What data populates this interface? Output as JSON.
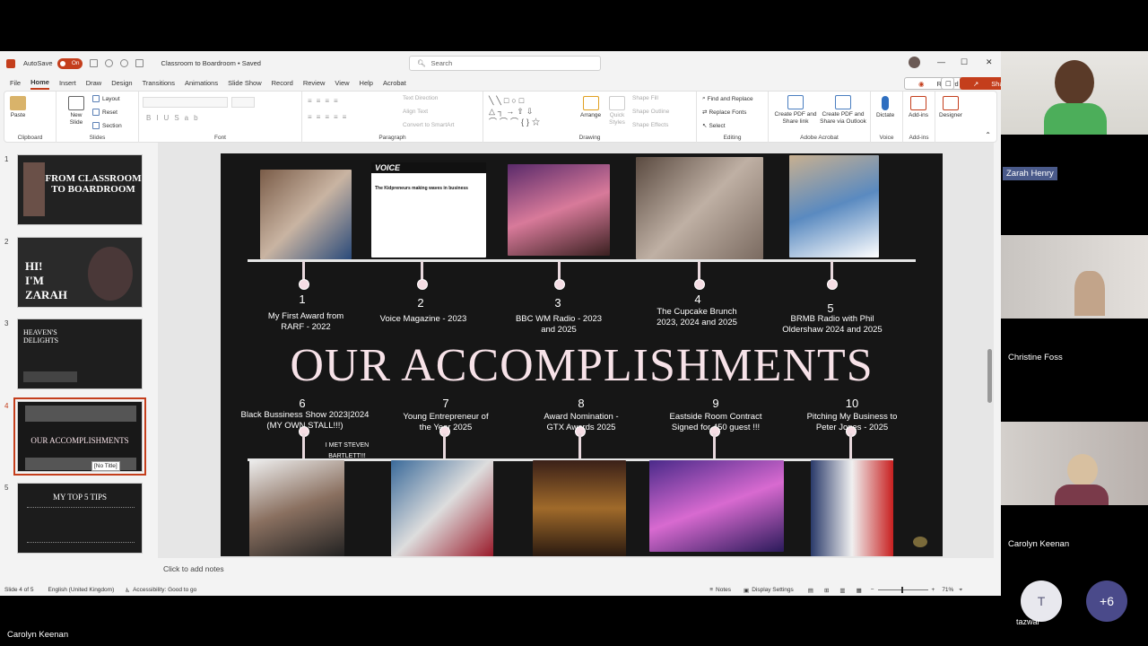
{
  "app": {
    "autosave": "AutoSave",
    "toggle": "On",
    "doc_title": "Classroom to Boardroom • Saved",
    "search_placeholder": "Search"
  },
  "tabs": [
    "File",
    "Home",
    "Insert",
    "Draw",
    "Design",
    "Transitions",
    "Animations",
    "Slide Show",
    "Record",
    "Review",
    "View",
    "Help",
    "Acrobat"
  ],
  "top_buttons": {
    "record": "Record",
    "share": "Share"
  },
  "ribbon": {
    "clipboard": {
      "label": "Clipboard",
      "paste": "Paste"
    },
    "slides": {
      "label": "Slides",
      "new_slide": "New Slide",
      "layout": "Layout",
      "reset": "Reset",
      "section": "Section"
    },
    "font": {
      "label": "Font"
    },
    "paragraph": {
      "label": "Paragraph",
      "text_direction": "Text Direction",
      "align_text": "Align Text",
      "convert": "Convert to SmartArt"
    },
    "drawing": {
      "label": "Drawing",
      "arrange": "Arrange",
      "quick_styles": "Quick Styles",
      "shape_fill": "Shape Fill",
      "shape_outline": "Shape Outline",
      "shape_effects": "Shape Effects"
    },
    "editing": {
      "label": "Editing",
      "find": "Find and Replace",
      "replace_fonts": "Replace Fonts",
      "select": "Select"
    },
    "acrobat": {
      "label": "Adobe Acrobat",
      "pdf_share": "Create PDF and Share link",
      "pdf_outlook": "Create PDF and Share via Outlook"
    },
    "voice": {
      "label": "Voice",
      "dictate": "Dictate"
    },
    "addins": {
      "label": "Add-ins",
      "addins": "Add-ins"
    },
    "designer": {
      "designer": "Designer"
    }
  },
  "thumbnails": [
    {
      "num": "1",
      "title": "FROM CLASSROOM TO BOARDROOM"
    },
    {
      "num": "2",
      "title": "HI! I'M ZARAH"
    },
    {
      "num": "3",
      "title": "HEAVEN'S DELIGHTS"
    },
    {
      "num": "4",
      "title": "OUR ACCOMPLISHMENTS",
      "tooltip": "[No Title]"
    },
    {
      "num": "5",
      "title": "MY TOP 5 TIPS"
    }
  ],
  "slide": {
    "title": "OUR ACCOMPLISHMENTS",
    "voice_logo": "VOICE",
    "voice_headline": "The Kidpreneurs making waves in business",
    "top": [
      {
        "n": "1",
        "text": "My First Award from RARF - 2022"
      },
      {
        "n": "2",
        "text": "Voice Magazine - 2023"
      },
      {
        "n": "3",
        "text": "BBC WM Radio - 2023 and 2025"
      },
      {
        "n": "4",
        "text": "The Cupcake Brunch 2023, 2024 and 2025"
      },
      {
        "n": "5",
        "text": "BRMB Radio with Phil Oldershaw 2024 and 2025"
      }
    ],
    "bottom": [
      {
        "n": "6",
        "text": "Black Bussiness Show 2023|2024 (MY OWN STALL!!!)"
      },
      {
        "n": "7",
        "text": "Young Entrepreneur of the Year 2025"
      },
      {
        "n": "8",
        "text": "Award Nomination - GTX Awards 2025"
      },
      {
        "n": "9",
        "text": "Eastside Room Contract Signed for 450 guest !!!"
      },
      {
        "n": "10",
        "text": "Pitching My Business to Peter Jones - 2025"
      }
    ],
    "steven": "I MET STEVEN BARTLETT!!!"
  },
  "notes_placeholder": "Click to add notes",
  "status": {
    "slide": "Slide 4 of 5",
    "lang": "English (United Kingdom)",
    "access": "Accessibility: Good to go",
    "notes": "Notes",
    "display": "Display Settings",
    "zoom": "71%"
  },
  "participants": [
    {
      "name": "Zarah Henry"
    },
    {
      "name": "Christine Foss"
    },
    {
      "name": "Carolyn Keenan"
    }
  ],
  "extra": {
    "initial": "T",
    "name": "tazwar",
    "more": "+6"
  },
  "active_speaker": "Carolyn Keenan"
}
